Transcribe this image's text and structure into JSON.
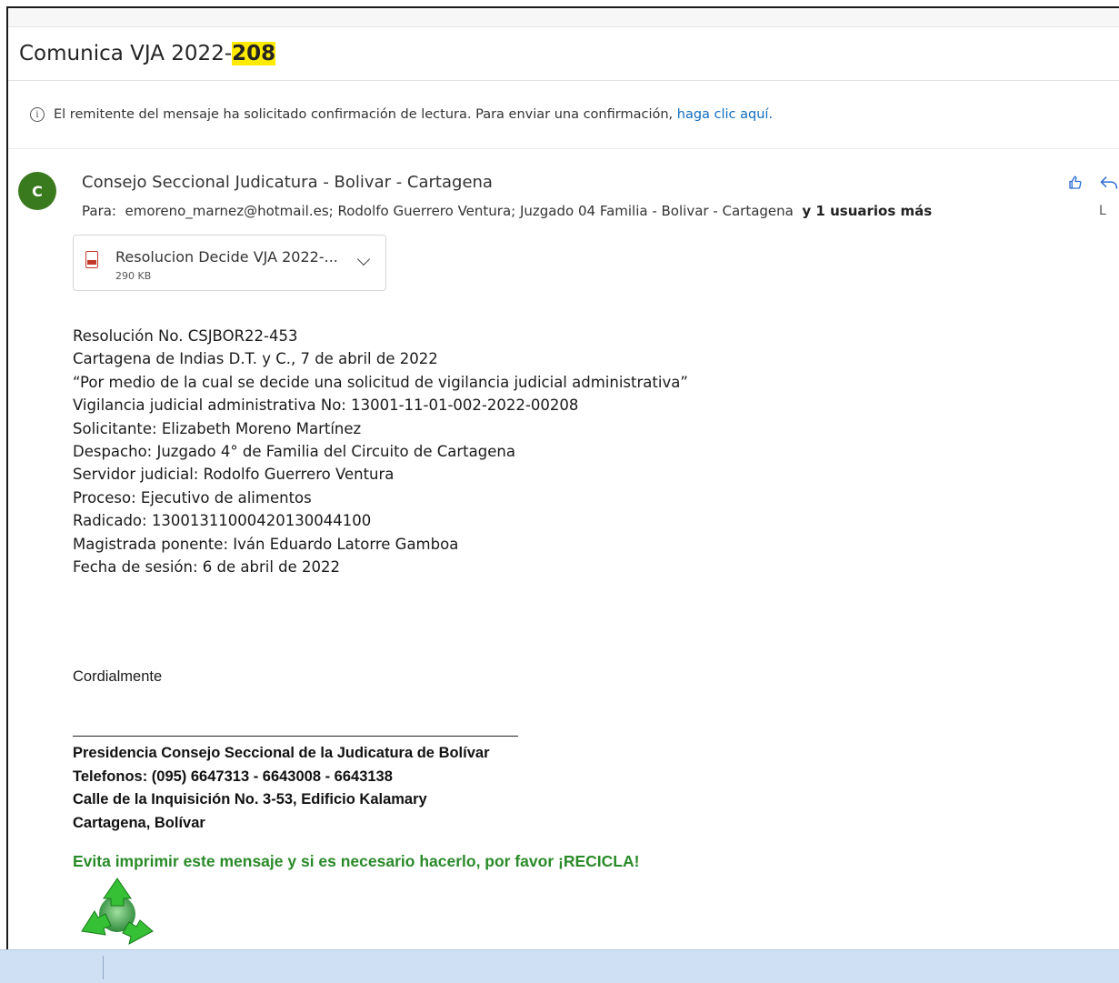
{
  "subject": {
    "prefix": "Comunica VJA 2022-",
    "highlight": "208"
  },
  "notice": {
    "icon": "info-icon",
    "text": "El remitente del mensaje ha solicitado confirmación de lectura. Para enviar una confirmación,",
    "link": "haga clic aquí."
  },
  "message_header": {
    "avatar_initial": "C",
    "avatar_color": "#3a7a1e",
    "sender": "Consejo Seccional Judicatura - Bolivar - Cartagena",
    "to_label": "Para:",
    "recipients": "emoreno_marnez@hotmail.es;  Rodolfo Guerrero Ventura;  Juzgado 04 Familia - Bolivar - Cartagena",
    "more_recipients": "y 1 usuarios más",
    "edge_letter": "L",
    "actions": {
      "like_icon": "like-icon",
      "reply_icon": "reply-icon"
    }
  },
  "attachment": {
    "icon": "pdf-icon",
    "name": "Resolucion Decide VJA 2022-...",
    "size": "290 KB"
  },
  "body_lines": [
    "Resolución No. CSJBOR22-453",
    "Cartagena de Indias D.T. y C., 7 de abril de 2022",
    "“Por medio de la cual se decide una solicitud de vigilancia judicial administrativa”",
    "Vigilancia judicial administrativa No: 13001-11-01-002-2022-00208",
    "Solicitante: Elizabeth Moreno Martínez",
    "Despacho: Juzgado 4° de Familia del Circuito de Cartagena",
    "Servidor judicial: Rodolfo Guerrero Ventura",
    "Proceso: Ejecutivo de alimentos",
    "Radicado: 13001311000420130044100",
    "Magistrada ponente: Iván Eduardo Latorre Gamboa",
    "Fecha de sesión: 6 de abril de 2022"
  ],
  "closing": "Cordialmente",
  "signature": [
    "Presidencia Consejo Seccional de la Judicatura de Bolívar",
    "Telefonos: (095) 6647313 - 6643008 - 6643138",
    "Calle de la Inquisición No. 3-53, Edificio Kalamary",
    "Cartagena, Bolívar"
  ],
  "recycle_notice": "Evita imprimir este mensaje y si es necesario hacerlo, por favor ¡RECICLA!",
  "colors": {
    "link": "#0f6cbd",
    "highlight": "#ffeb00",
    "recycle_green": "#2a8a2a",
    "bottom_bar": "#cfe0f5"
  }
}
